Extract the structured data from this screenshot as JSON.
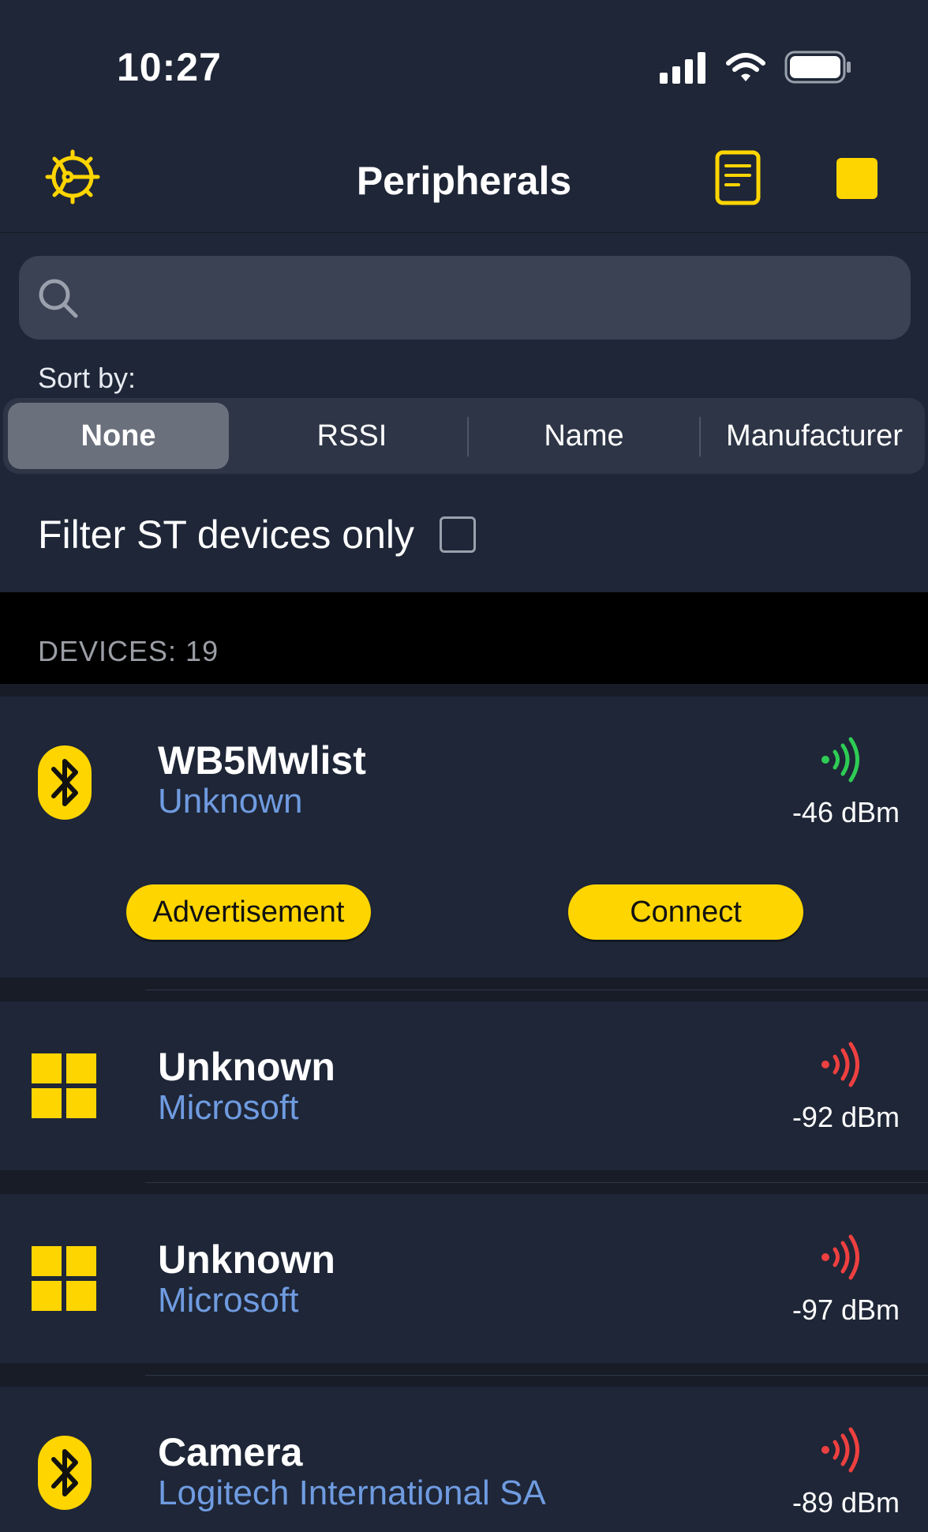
{
  "status_bar": {
    "time": "10:27",
    "signal_icon": "cellular-signal-icon",
    "wifi_icon": "wifi-icon",
    "battery_icon": "battery-icon"
  },
  "nav": {
    "title": "Peripherals",
    "settings_icon": "gear-icon",
    "log_icon": "document-icon",
    "stop_icon": "stop-square-icon"
  },
  "search": {
    "placeholder": "",
    "value": ""
  },
  "sort": {
    "label": "Sort by:",
    "options": [
      "None",
      "RSSI",
      "Name",
      "Manufacturer"
    ],
    "selected": "None"
  },
  "filter": {
    "label": "Filter ST devices only",
    "checked": false
  },
  "devices_header": "DEVICES: 19",
  "devices": [
    {
      "name": "WB5Mwlist",
      "manufacturer": "Unknown",
      "icon": "bluetooth-icon",
      "rssi": "-46 dBm",
      "signal_color": "#2fcc55",
      "expanded": true,
      "advertisement_label": "Advertisement",
      "connect_label": "Connect"
    },
    {
      "name": "Unknown",
      "manufacturer": "Microsoft",
      "icon": "windows-icon",
      "rssi": "-92 dBm",
      "signal_color": "#ee4040"
    },
    {
      "name": "Unknown",
      "manufacturer": "Microsoft",
      "icon": "windows-icon",
      "rssi": "-97 dBm",
      "signal_color": "#ee4040"
    },
    {
      "name": "Camera",
      "manufacturer": "Logitech International SA",
      "icon": "bluetooth-icon",
      "rssi": "-89 dBm",
      "signal_color": "#ee4040"
    }
  ],
  "colors": {
    "accent": "#ffd500",
    "background": "#1e2637",
    "manufacturer_text": "#6f9be0"
  }
}
